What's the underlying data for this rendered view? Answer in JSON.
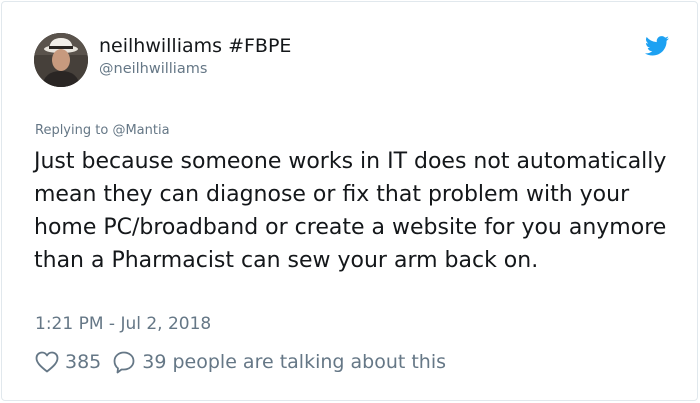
{
  "author": {
    "display_name": "neilhwilliams #FBPE",
    "handle": "@neilhwilliams"
  },
  "reply": {
    "prefix": "Replying to ",
    "mention": "@Mantia"
  },
  "tweet": {
    "text": "Just because someone works in IT does not automatically mean they can diagnose or fix that problem with your home PC/broadband or create a website for you anymore than a Pharmacist can sew your arm back on.",
    "timestamp": "1:21 PM - Jul 2, 2018"
  },
  "engagement": {
    "likes": "385",
    "conversation": "39 people are talking about this"
  },
  "icons": {
    "brand": "twitter-bird-icon",
    "like": "heart-icon",
    "reply": "speech-bubble-icon"
  },
  "colors": {
    "brand_blue": "#1da1f2",
    "secondary_text": "#657786",
    "primary_text": "#14171a",
    "border": "#e1e8ed"
  }
}
